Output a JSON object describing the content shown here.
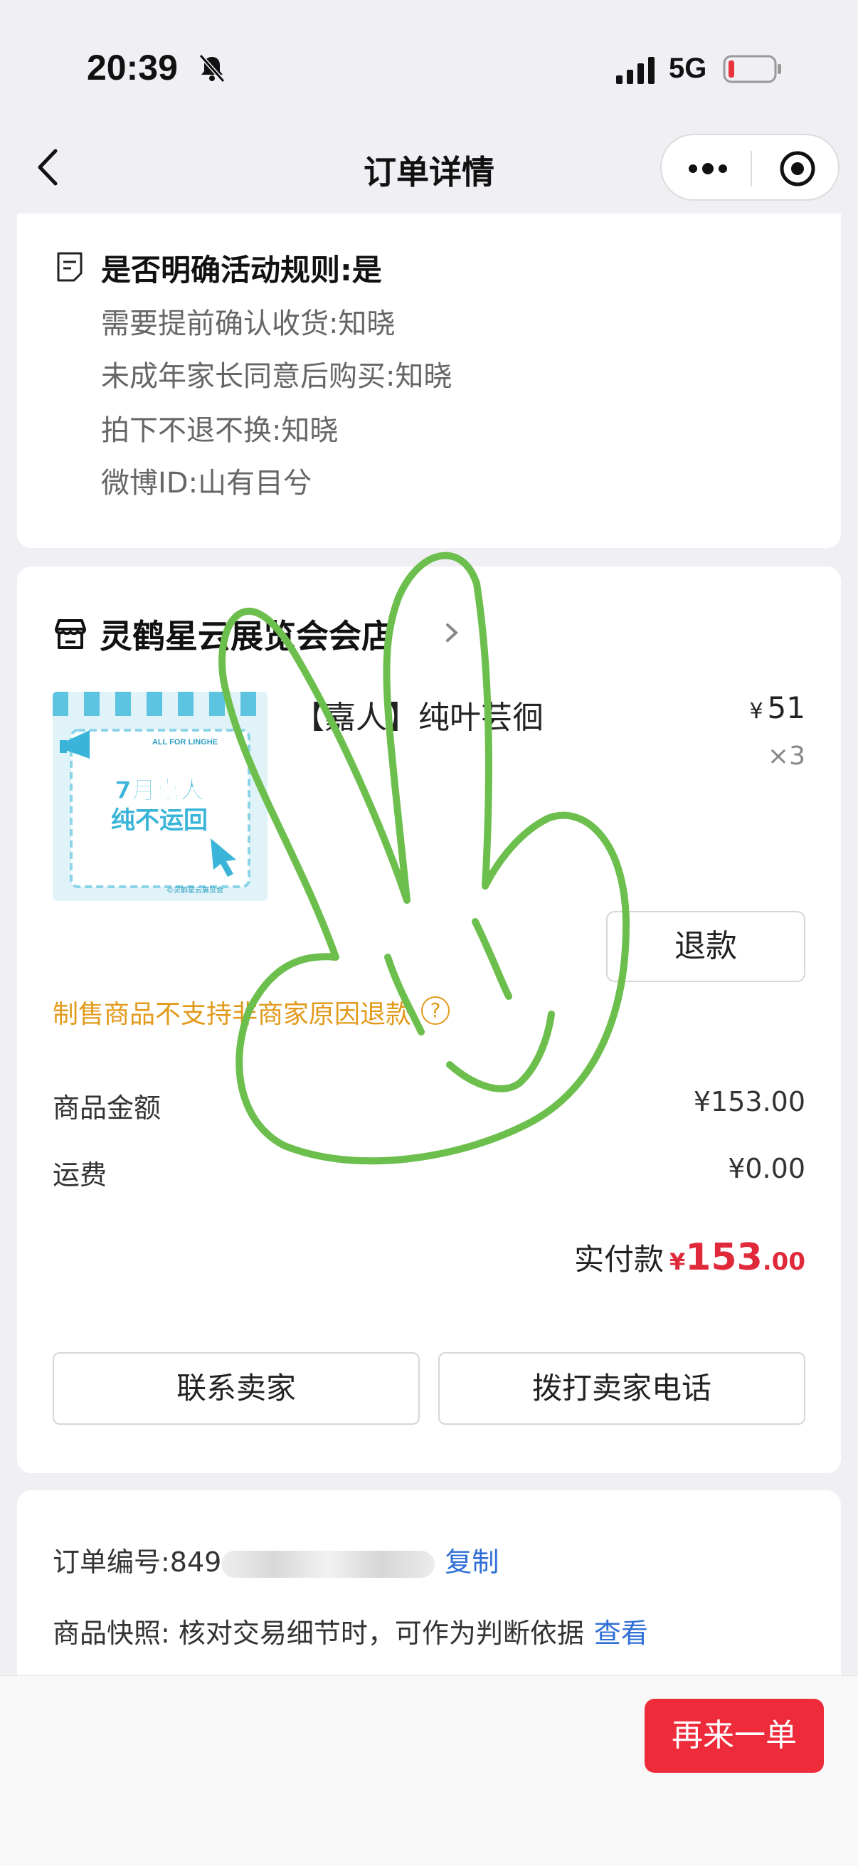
{
  "status_bar": {
    "time": "20:39",
    "network": "5G"
  },
  "nav": {
    "title": "订单详情"
  },
  "rules": {
    "title": "是否明确活动规则:是",
    "lines": [
      "需要提前确认收货:知晓",
      "未成年家长同意后购买:知晓",
      "拍下不退不换:知晓",
      "微博ID:山有目兮"
    ]
  },
  "store": {
    "name": "灵鹤星云展览会会店",
    "product": {
      "name": "【嘉人】纯叶芸徊",
      "currency": "¥",
      "price": "51",
      "qty": "×3",
      "thumb": {
        "banner": "ALL FOR LINGHE",
        "line1": "7月嘉人",
        "line2": "纯不运回",
        "footer": "©灵鹤星云展览会"
      }
    },
    "refund_label": "退款",
    "refund_note": "制售商品不支持非商家原因退款",
    "help_mark": "?",
    "fees": [
      {
        "label": "商品金额",
        "value": "¥153.00"
      },
      {
        "label": "运费",
        "value": "¥0.00"
      }
    ],
    "total": {
      "label": "实付款",
      "currency": "¥",
      "integer": "153",
      "decimal": ".00"
    },
    "actions": {
      "contact": "联系卖家",
      "call": "拨打卖家电话"
    }
  },
  "order": {
    "number_label": "订单编号:849",
    "copy_label": "复制",
    "snapshot_label": "商品快照: 核对交易细节时，可作为判断依据",
    "view_label": "查看"
  },
  "bottom": {
    "reorder_label": "再来一单"
  },
  "colors": {
    "accent_red": "#ee2b3b",
    "link_blue": "#2f6fd6",
    "warning_orange": "#e29a1b",
    "doodle_green": "#6cbf4d"
  }
}
